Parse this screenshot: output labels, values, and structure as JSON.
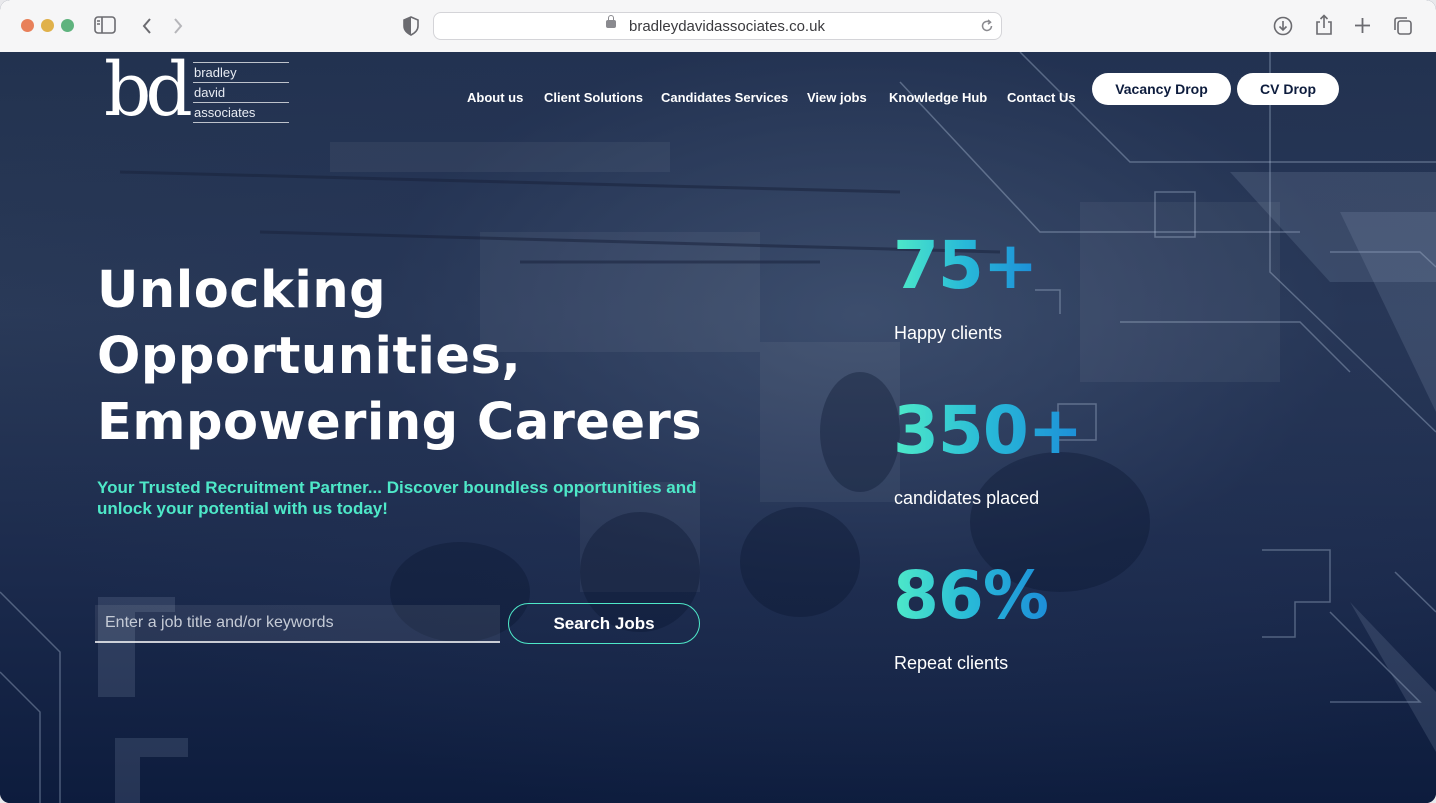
{
  "browser": {
    "url": "bradleydavidassociates.co.uk",
    "traffic_colors": [
      "#e8805a",
      "#e0b14a",
      "#5fb37e"
    ]
  },
  "logo": {
    "mark": "bd",
    "words": [
      "bradley",
      "david",
      "associates"
    ]
  },
  "nav": {
    "items": [
      "About us",
      "Client Solutions",
      "Candidates Services",
      "View jobs",
      "Knowledge Hub",
      "Contact Us"
    ],
    "vacancy_drop": "Vacancy Drop",
    "cv_drop": "CV Drop"
  },
  "hero": {
    "headline": [
      "Unlocking",
      "Opportunities,",
      "Empowering Careers"
    ],
    "subline": "Your Trusted Recruitment Partner... Discover boundless opportunities and unlock your potential with us today!",
    "search_placeholder": "Enter a job title and/or keywords",
    "search_value": "",
    "search_button": "Search Jobs"
  },
  "stats": [
    {
      "value": "75+",
      "label": "Happy clients"
    },
    {
      "value": "350+",
      "label": "candidates placed"
    },
    {
      "value": "86%",
      "label": "Repeat clients"
    }
  ],
  "colors": {
    "accent": "#4ee8c8",
    "navy": "#0d1c3d",
    "stat_gradient_end": "#1d8ed8"
  }
}
